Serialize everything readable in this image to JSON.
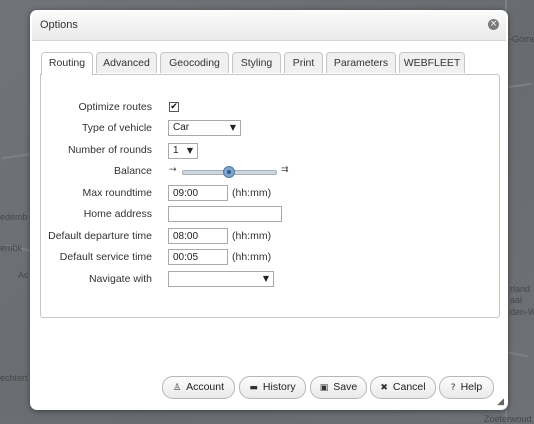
{
  "dialog": {
    "title": "Options",
    "close_icon": "×"
  },
  "tabs": [
    {
      "label": "Routing",
      "active": true
    },
    {
      "label": "Advanced"
    },
    {
      "label": "Geocoding"
    },
    {
      "label": "Styling"
    },
    {
      "label": "Print"
    },
    {
      "label": "Parameters"
    },
    {
      "label": "WEBFLEET"
    }
  ],
  "form": {
    "optimize_routes": {
      "label": "Optimize routes",
      "checked": true,
      "mark": "✔"
    },
    "vehicle_type": {
      "label": "Type of vehicle",
      "value": "Car"
    },
    "rounds": {
      "label": "Number of rounds",
      "value": "1"
    },
    "balance": {
      "label": "Balance",
      "left_icon": "→",
      "right_icon": "⇉",
      "level": 0.5
    },
    "max_roundtime": {
      "label": "Max roundtime",
      "value": "09:00",
      "unit": "(hh:mm)"
    },
    "home_address": {
      "label": "Home address",
      "value": ""
    },
    "departure_time": {
      "label": "Default departure time",
      "value": "08:00",
      "unit": "(hh:mm)"
    },
    "service_time": {
      "label": "Default service time",
      "value": "00:05",
      "unit": "(hh:mm)"
    },
    "navigate_with": {
      "label": "Navigate with",
      "value": ""
    },
    "dropdown_arrow": "▼"
  },
  "buttons": {
    "account": {
      "label": "Account",
      "icon": "person-icon",
      "glyph": "♙"
    },
    "history": {
      "label": "History",
      "icon": "folder-icon",
      "glyph": "▬"
    },
    "save": {
      "label": "Save",
      "icon": "save-icon",
      "glyph": "▣"
    },
    "cancel": {
      "label": "Cancel",
      "icon": "cross-icon",
      "glyph": "✖"
    },
    "help": {
      "label": "Help",
      "icon": "question-icon",
      "glyph": "?"
    }
  },
  "background_map_labels": [
    "edemb",
    "embk",
    "Ac",
    "echtert",
    "-Gome",
    "rland",
    "aal",
    "den-Wi",
    "Zoeterwoud"
  ],
  "colors": {
    "accent": "#4f79a7",
    "background": "#6b6e73"
  }
}
